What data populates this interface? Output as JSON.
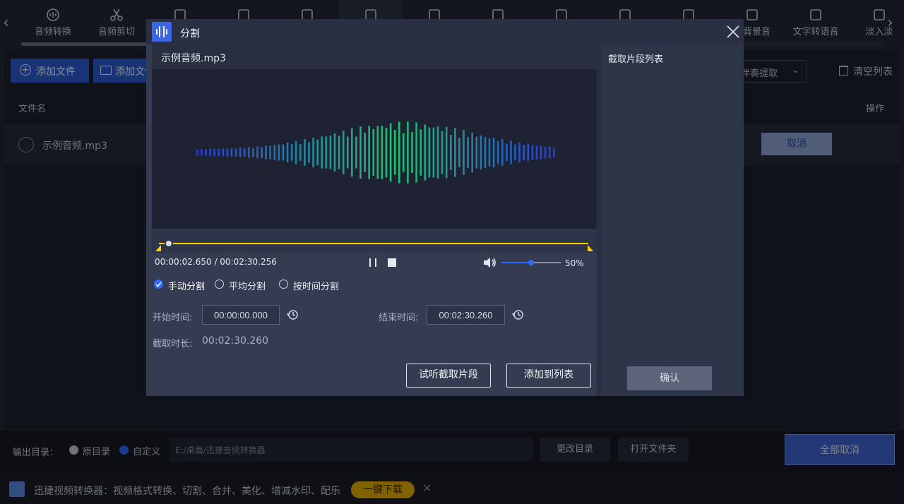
{
  "toolbar": {
    "tools": [
      {
        "label": "音频转换",
        "icon": "audio-convert-icon"
      },
      {
        "label": "音频剪切",
        "icon": "scissors-icon"
      },
      {
        "label": "",
        "icon": "export-icon"
      },
      {
        "label": "",
        "icon": "compress-icon"
      },
      {
        "label": "",
        "icon": "merge-icon"
      },
      {
        "label": "",
        "icon": "split-icon"
      },
      {
        "label": "",
        "icon": "volume-icon"
      },
      {
        "label": "",
        "icon": "microphone-icon"
      },
      {
        "label": "",
        "icon": "equalizer-icon"
      },
      {
        "label": "",
        "icon": "bars-icon"
      },
      {
        "label": "",
        "icon": "speed-icon"
      },
      {
        "label": "加背景音",
        "icon": "music-note-icon"
      },
      {
        "label": "文字转语音",
        "icon": "text-to-speech-icon"
      },
      {
        "label": "淡入淡",
        "icon": "fade-icon"
      }
    ]
  },
  "main": {
    "add_file": "添加文件",
    "add_folder": "添加文件",
    "accompany_extract": "伴奏提取",
    "clear_list": "清空列表",
    "col_filename": "文件名",
    "col_action": "操作",
    "file_name": "示例音频.mp3",
    "cancel_label": "取消"
  },
  "output": {
    "label": "输出目录：",
    "option_original": "原目录",
    "option_custom": "自定义",
    "path": "E:/桌面/迅捷音频转换器",
    "change_dir": "更改目录",
    "open_folder": "打开文件夹",
    "cancel_all": "全部取消"
  },
  "promo": {
    "text": "迅捷视频转换器：视频格式转换、切割、合并、美化、增减水印、配乐",
    "download": "一键下载"
  },
  "dialog": {
    "title": "分割",
    "file_name": "示例音频.mp3",
    "time_current": "00:00:02.650",
    "time_total": "00:02:30.256",
    "volume_percent": "50%",
    "volume_level": 0.5,
    "progress_fraction": 0.018,
    "modes": [
      {
        "label": "手动分割",
        "checked": true
      },
      {
        "label": "平均分割",
        "checked": false
      },
      {
        "label": "按时间分割",
        "checked": false
      }
    ],
    "start_label": "开始时间:",
    "start_value": "00:00:00.000",
    "end_label": "结束时间:",
    "end_value": "00:02:30.260",
    "duration_label": "截取时长:",
    "duration_value": "00:02:30.260",
    "preview_button": "试听截取片段",
    "add_button": "添加到列表",
    "segment_list_title": "截取片段列表",
    "confirm_button": "确认"
  },
  "colors": {
    "accent": "#2f6bff",
    "wave_start": "#2a3ad8",
    "wave_mid": "#1fc46e",
    "wave_end": "#2a3ad8",
    "timeline_yellow": "#ffd200"
  }
}
